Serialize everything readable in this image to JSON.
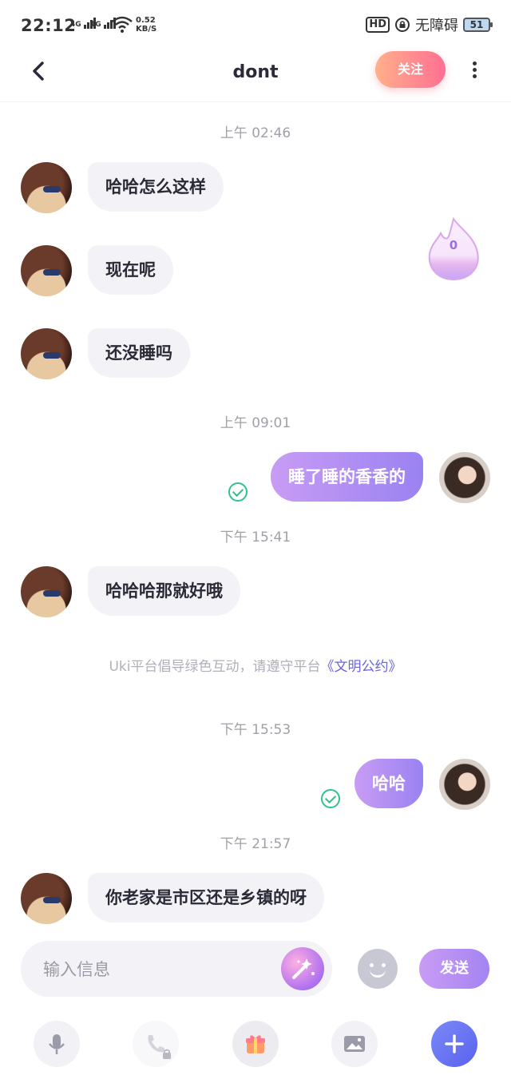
{
  "status_bar": {
    "time": "22:12",
    "network1": "4G",
    "network2": "4G",
    "speed_value": "0.52",
    "speed_unit": "KB/S",
    "hd": "HD",
    "accessibility": "无障碍",
    "battery": "51"
  },
  "header": {
    "title": "dont",
    "follow_label": "关注"
  },
  "flame_badge": {
    "count": "0"
  },
  "messages": [
    {
      "type": "time",
      "text": "上午 02:46"
    },
    {
      "type": "in",
      "text": "哈哈怎么这样"
    },
    {
      "type": "in",
      "text": "现在呢"
    },
    {
      "type": "in",
      "text": "还没睡吗"
    },
    {
      "type": "time",
      "text": "上午 09:01"
    },
    {
      "type": "out",
      "text": "睡了睡的香香的"
    },
    {
      "type": "time",
      "text": "下午 15:41"
    },
    {
      "type": "in",
      "text": "哈哈哈那就好哦"
    },
    {
      "type": "time",
      "text": "下午 15:53"
    },
    {
      "type": "out",
      "text": "哈哈"
    },
    {
      "type": "time",
      "text": "下午 21:57"
    },
    {
      "type": "in",
      "text": "你老家是市区还是乡镇的呀"
    }
  ],
  "notice": {
    "prefix": "Uki平台倡导绿色互动，请遵守平台",
    "link": "《文明公约》"
  },
  "composer": {
    "placeholder": "输入信息",
    "send_label": "发送"
  },
  "toolbar": {
    "items": [
      "microphone-icon",
      "phone-locked-icon",
      "gift-icon",
      "image-icon",
      "plus-icon"
    ]
  },
  "colors": {
    "accent_purple": "#9a82f2",
    "follow_gradient_start": "#ffb08a",
    "follow_gradient_end": "#ff6f93",
    "read_check": "#2cc48a",
    "link": "#6a62e0"
  }
}
